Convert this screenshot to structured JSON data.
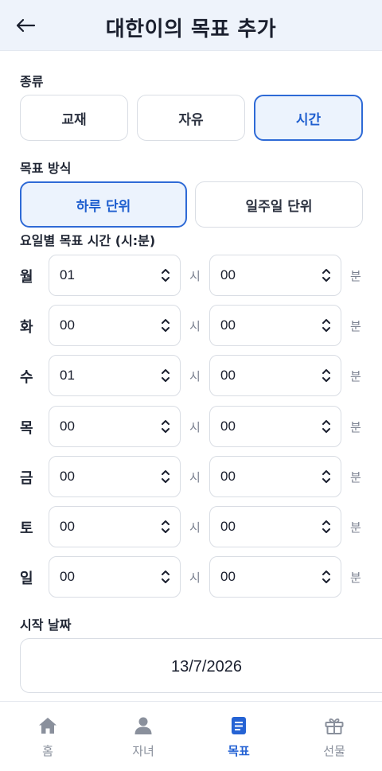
{
  "header": {
    "title": "대한이의 목표 추가"
  },
  "category": {
    "label": "종류",
    "options": [
      {
        "label": "교재",
        "active": false
      },
      {
        "label": "자유",
        "active": false
      },
      {
        "label": "시간",
        "active": true
      }
    ]
  },
  "method": {
    "label": "목표 방식",
    "options": [
      {
        "label": "하루 단위",
        "active": true
      },
      {
        "label": "일주일 단위",
        "active": false
      }
    ]
  },
  "schedule": {
    "label": "요일별 목표 시간 (시:분)",
    "hour_unit": "시",
    "minute_unit": "분",
    "days": [
      {
        "day": "월",
        "hours": "01",
        "minutes": "00"
      },
      {
        "day": "화",
        "hours": "00",
        "minutes": "00"
      },
      {
        "day": "수",
        "hours": "01",
        "minutes": "00"
      },
      {
        "day": "목",
        "hours": "00",
        "minutes": "00"
      },
      {
        "day": "금",
        "hours": "00",
        "minutes": "00"
      },
      {
        "day": "토",
        "hours": "00",
        "minutes": "00"
      },
      {
        "day": "일",
        "hours": "00",
        "minutes": "00"
      }
    ]
  },
  "start_date": {
    "label": "시작 날짜",
    "value": "13/7/2026"
  },
  "tabbar": {
    "tabs": [
      {
        "label": "홈",
        "icon": "home-icon",
        "active": false
      },
      {
        "label": "자녀",
        "icon": "person-icon",
        "active": false
      },
      {
        "label": "목표",
        "icon": "document-icon",
        "active": true
      },
      {
        "label": "선물",
        "icon": "gift-icon",
        "active": false
      }
    ]
  },
  "colors": {
    "accent": "#2563d4",
    "active_bg": "#ecf3fd",
    "header_bg": "#eef3fb",
    "inactive_icon": "#8a909c"
  }
}
